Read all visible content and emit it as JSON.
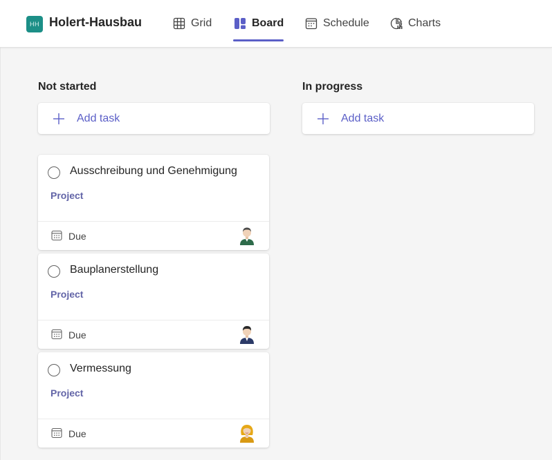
{
  "header": {
    "plan_initials": "HH",
    "plan_title": "Holert-Hausbau",
    "tabs": [
      {
        "label": "Grid",
        "icon": "grid-icon"
      },
      {
        "label": "Board",
        "icon": "board-icon",
        "active": true
      },
      {
        "label": "Schedule",
        "icon": "calendar-icon"
      },
      {
        "label": "Charts",
        "icon": "charts-icon"
      }
    ]
  },
  "colors": {
    "accent": "#5b5fc7",
    "label": "#6264a7",
    "plan_avatar": "#1c8f87"
  },
  "buckets": [
    {
      "title": "Not started",
      "add_label": "Add task",
      "tasks": [
        {
          "title": "Ausschreibung und Genehmigung",
          "label": "Project",
          "due": "Due",
          "assignee_icon": "male-avatar-green-icon"
        },
        {
          "title": "Bauplanerstellung",
          "label": "Project",
          "due": "Due",
          "assignee_icon": "male-avatar-navy-icon"
        },
        {
          "title": "Vermessung",
          "label": "Project",
          "due": "Due",
          "assignee_icon": "female-avatar-icon"
        }
      ]
    },
    {
      "title": "In progress",
      "add_label": "Add task",
      "tasks": []
    }
  ]
}
